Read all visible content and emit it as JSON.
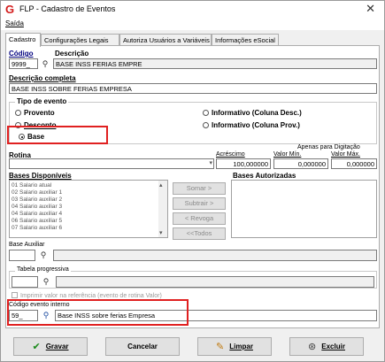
{
  "window": {
    "app_icon": "G",
    "title": "FLP - Cadastro de Eventos",
    "close": "✕"
  },
  "menu": {
    "saida": "Saída"
  },
  "tabs": [
    {
      "label": "Cadastro"
    },
    {
      "label": "Configurações Legais"
    },
    {
      "label": "Autoriza Usuários a Variáveis"
    },
    {
      "label": "Informações eSocial"
    }
  ],
  "form": {
    "codigo_label": "Código",
    "descricao_label": "Descrição",
    "codigo_value": "9999_",
    "descricao_value": "BASE INSS FERIAS EMPRE",
    "descricao_completa_label": "Descrição completa",
    "descricao_completa_value": "BASE INSS SOBRE FERIAS EMPRESA"
  },
  "tipo_evento": {
    "legend": "Tipo de evento",
    "options": [
      {
        "label": "Provento",
        "selected": false
      },
      {
        "label": "Desconto",
        "selected": false
      },
      {
        "label": "Base",
        "selected": true
      },
      {
        "label": "Informativo (Coluna Desc.)",
        "selected": false
      },
      {
        "label": "Informativo (Coluna Prov.)",
        "selected": false
      }
    ]
  },
  "rotina": {
    "label": "Rotina",
    "apenas_label": "Apenas para Digitação",
    "acrescimo_label": "Acréscimo",
    "valor_min_label": "Valor Mín.",
    "valor_max_label": "Valor Máx.",
    "acrescimo_value": "100,000000",
    "valor_min_value": "0,000000",
    "valor_max_value": "0,000000"
  },
  "bases": {
    "disponiveis_label": "Bases Disponíveis",
    "autorizadas_label": "Bases Autorizadas",
    "items": [
      "01 Salario atual",
      "02 Salario auxiliar 1",
      "03 Salario auxiliar 2",
      "04 Salario auxiliar 3",
      "04 Salario auxiliar 4",
      "06 Salario auxiliar 5",
      "07 Salario auxiliar 6"
    ],
    "somar": "Somar >",
    "subtrair": "Subtrair >",
    "revoga": "< Revoga",
    "todos": "<<Todos"
  },
  "base_auxiliar": {
    "label": "Base Auxiliar",
    "code": "",
    "desc": ""
  },
  "tabela_progressiva": {
    "legend": "Tabela progressiva",
    "code": "",
    "desc": ""
  },
  "imprimir": {
    "label": "Imprimir valor na referência (evento de rotina Valor)",
    "checked": false
  },
  "codigo_interno": {
    "label": "Código evento interno",
    "code": "59_",
    "desc": "Base INSS sobre ferias Empresa"
  },
  "buttons": {
    "gravar": "Gravar",
    "cancelar": "Cancelar",
    "limpar": "Limpar",
    "excluir": "Excluir"
  },
  "colors": {
    "highlight": "#e02020",
    "label_blue": "#00007f"
  }
}
